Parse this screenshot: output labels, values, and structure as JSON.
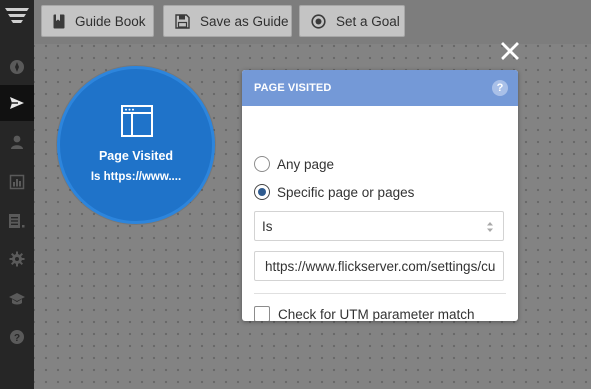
{
  "toolbar": {
    "guide_book_label": "Guide Book",
    "save_as_guide_label": "Save as Guide",
    "set_a_goal_label": "Set a Goal"
  },
  "sidebar": {
    "items": [
      {
        "icon": "menu-logo-icon"
      },
      {
        "icon": "compass-icon"
      },
      {
        "icon": "paper-plane-icon",
        "active": true
      },
      {
        "icon": "user-icon"
      },
      {
        "icon": "bar-chart-icon"
      },
      {
        "icon": "list-icon"
      },
      {
        "icon": "gear-icon"
      },
      {
        "icon": "graduation-cap-icon"
      },
      {
        "icon": "help-icon"
      }
    ]
  },
  "step": {
    "title": "Page Visited",
    "subtitle": "Is https://www...."
  },
  "panel": {
    "title": "PAGE VISITED",
    "help_glyph": "?",
    "options": {
      "any_page": "Any page",
      "specific_pages": "Specific page or pages",
      "selected": "specific_pages"
    },
    "match_select_value": "Is",
    "url_value": "https://www.flickserver.com/settings/cu",
    "utm_checkbox_label": "Check for UTM parameter match",
    "utm_checked": false
  },
  "colors": {
    "accent": "#7499d7",
    "step_circle": "#1f73c9",
    "sidebar": "#262626",
    "canvas": "#838383"
  }
}
